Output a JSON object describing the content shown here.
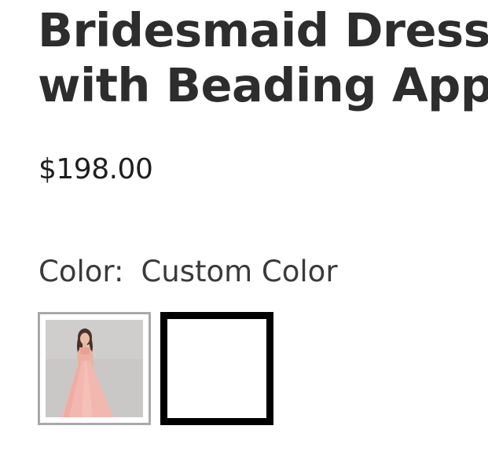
{
  "product": {
    "title_line1": "Bridesmaid Dress",
    "title_line2": "with Beading App",
    "price": "$198.00"
  },
  "color": {
    "label": "Color:",
    "selected_value": "Custom Color",
    "swatches": [
      {
        "type": "image",
        "icon": "dress-photo-icon",
        "dress_color": "#f2b7ae"
      },
      {
        "type": "custom",
        "icon": "blank-swatch"
      }
    ]
  },
  "colors": {
    "text": "#2b2b2b",
    "selected_border": "#000000",
    "unselected_border": "#a9a9a9"
  }
}
